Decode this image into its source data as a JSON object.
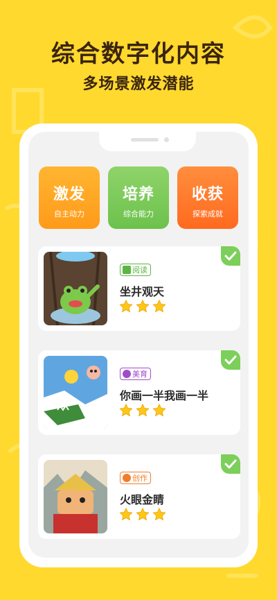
{
  "header": {
    "title": "综合数字化内容",
    "subtitle": "多场景激发潜能"
  },
  "tiles": [
    {
      "title": "激发",
      "subtitle": "自主动力",
      "color": "#ffa726"
    },
    {
      "title": "培养",
      "subtitle": "综合能力",
      "color": "#7ccb58"
    },
    {
      "title": "收获",
      "subtitle": "探索成就",
      "color": "#ff7a2e"
    }
  ],
  "cards": [
    {
      "badge": "阅读",
      "badge_icon": "book-icon",
      "title": "坐井观天",
      "rating": 3,
      "completed": true
    },
    {
      "badge": "美育",
      "badge_icon": "palette-icon",
      "title": "你画一半我画一半",
      "rating": 3,
      "completed": true
    },
    {
      "badge": "创作",
      "badge_icon": "brush-icon",
      "title": "火眼金睛",
      "rating": 3,
      "completed": true
    }
  ],
  "colors": {
    "background": "#ffd92e",
    "check": "#7ccf5a",
    "star": "#ffc61a"
  }
}
